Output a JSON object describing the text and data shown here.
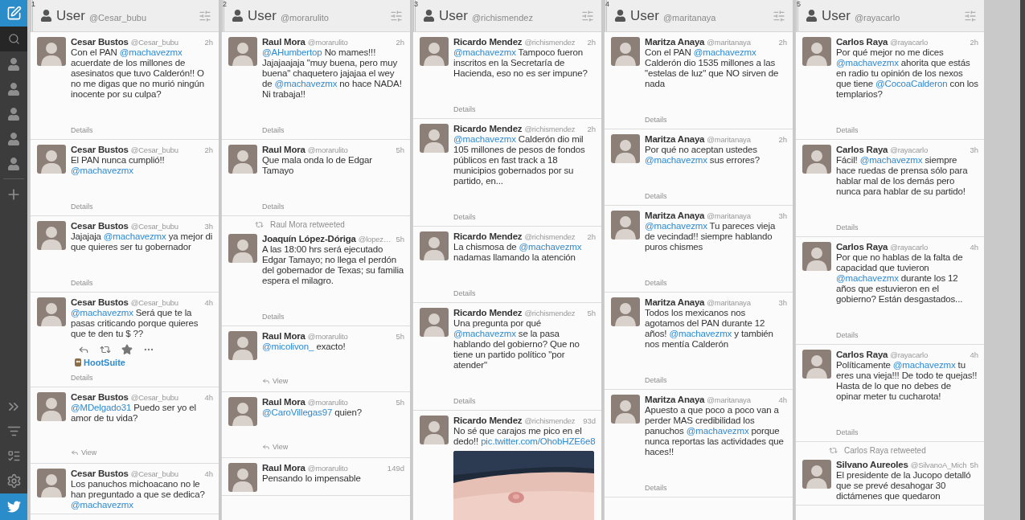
{
  "sidebar": {
    "top": [
      {
        "kind": "compose",
        "selected": false
      },
      {
        "kind": "search",
        "selected": true
      },
      {
        "kind": "user",
        "selected": false
      },
      {
        "kind": "user",
        "selected": false
      },
      {
        "kind": "user",
        "selected": false
      },
      {
        "kind": "user",
        "selected": false
      },
      {
        "kind": "user",
        "selected": false
      },
      {
        "kind": "add",
        "selected": false
      }
    ],
    "bottom": [
      {
        "kind": "expand"
      },
      {
        "kind": "list-users"
      },
      {
        "kind": "list-tools"
      },
      {
        "kind": "settings"
      },
      {
        "kind": "twitter"
      }
    ]
  },
  "columns": [
    {
      "number": "1",
      "title": "User",
      "handle": "@Cesar_bubu",
      "tweets": [
        {
          "name": "Cesar Bustos",
          "handle": "@Cesar_bubu",
          "time": "2h",
          "text": [
            "Con el PAN ",
            {
              "link": "@machavezmx"
            },
            " acuerdate de los millones de asesinatos que tuvo Calderón!! O no me digas que no murió ningún inocente por su culpa?"
          ],
          "footer": {
            "kind": "details",
            "label": "Details"
          }
        },
        {
          "name": "Cesar Bustos",
          "handle": "@Cesar_bubu",
          "time": "2h",
          "text": [
            "El PAN nunca cumplió!! ",
            {
              "link": "@machavezmx"
            }
          ],
          "footer": {
            "kind": "details",
            "label": "Details"
          }
        },
        {
          "name": "Cesar Bustos",
          "handle": "@Cesar_bubu",
          "time": "3h",
          "text": [
            "Jajajaja ",
            {
              "link": "@machavezmx"
            },
            " ya mejor di que quieres ser tu gobernador"
          ],
          "footer": {
            "kind": "details",
            "label": "Details"
          }
        },
        {
          "name": "Cesar Bustos",
          "handle": "@Cesar_bubu",
          "time": "4h",
          "text": [
            {
              "link": "@machavezmx"
            },
            " Será que te la pasas criticando porque quieres que te den tu $ ??"
          ],
          "hovered": true,
          "via": "HootSuite",
          "footer": {
            "kind": "details",
            "label": "Details"
          }
        },
        {
          "name": "Cesar Bustos",
          "handle": "@Cesar_bubu",
          "time": "4h",
          "text": [
            {
              "link": "@MDelgado31"
            },
            " Puedo ser yo el amor de tu vida?"
          ],
          "footer": {
            "kind": "conversation",
            "label": "View"
          }
        },
        {
          "name": "Cesar Bustos",
          "handle": "@Cesar_bubu",
          "time": "4h",
          "text": [
            "Los panuchos michoacano no le han preguntado a que se dedica? ",
            {
              "link": "@machavezmx"
            }
          ]
        }
      ]
    },
    {
      "number": "2",
      "title": "User",
      "handle": "@morarulito",
      "tweets": [
        {
          "name": "Raul Mora",
          "handle": "@morarulito",
          "time": "2h",
          "text": [
            {
              "link": "@AHumbertop"
            },
            " No mames!!! Jajajaajaja \"muy buena, pero muy buena\" chaquetero jajajaa el wey de ",
            {
              "link": "@machavezmx"
            },
            " no hace NADA! Ni trabaja!!"
          ],
          "footer": {
            "kind": "details",
            "label": "Details"
          }
        },
        {
          "name": "Raul Mora",
          "handle": "@morarulito",
          "time": "5h",
          "text": [
            "Que mala onda lo de Edgar Tamayo"
          ],
          "footer": {
            "kind": "details",
            "label": "Details"
          }
        },
        {
          "retweeted_by": "Raul Mora retweeted",
          "name": "Joaquín López-Dóriga",
          "handle": "@lopez…",
          "time": "5h",
          "text": [
            "A las 18:00 hrs será ejecutado Edgar Tamayo; no llega el perdón del gobernador de Texas; su familia espera el milagro."
          ],
          "footer": {
            "kind": "details",
            "label": "Details"
          }
        },
        {
          "name": "Raul Mora",
          "handle": "@morarulito",
          "time": "5h",
          "text": [
            {
              "link": "@micolivon_"
            },
            " exacto!"
          ],
          "footer": {
            "kind": "conversation",
            "label": "View"
          }
        },
        {
          "name": "Raul Mora",
          "handle": "@morarulito",
          "time": "5h",
          "text": [
            {
              "link": "@CaroVillegas97"
            },
            " quien?"
          ],
          "footer": {
            "kind": "conversation",
            "label": "View"
          }
        },
        {
          "name": "Raul Mora",
          "handle": "@morarulito",
          "time": "149d",
          "text": [
            "Pensando lo impensable"
          ]
        }
      ]
    },
    {
      "number": "3",
      "title": "User",
      "handle": "@richismendez",
      "tweets": [
        {
          "name": "Ricardo Mendez",
          "handle": "@richismendez",
          "time": "2h",
          "text": [
            {
              "link": "@machavezmx"
            },
            " Tampoco fueron inscritos en la Secretaría de Hacienda, eso no es ser impune?"
          ],
          "footer": {
            "kind": "details",
            "label": "Details"
          }
        },
        {
          "name": "Ricardo Mendez",
          "handle": "@richismendez",
          "time": "2h",
          "text": [
            {
              "link": "@machavezmx"
            },
            " Calderón dio mil 105 millones de pesos de fondos públicos en fast track a 18 municipios gobernados por su partido, en..."
          ],
          "footer": {
            "kind": "details",
            "label": "Details"
          }
        },
        {
          "name": "Ricardo Mendez",
          "handle": "@richismendez",
          "time": "2h",
          "text": [
            "La chismosa de ",
            {
              "link": "@machavezmx"
            },
            " nadamas llamando la atención"
          ],
          "footer": {
            "kind": "details",
            "label": "Details"
          }
        },
        {
          "name": "Ricardo Mendez",
          "handle": "@richismendez",
          "time": "5h",
          "text": [
            "Una pregunta por qué ",
            {
              "link": "@machavezmx"
            },
            " se la pasa hablando del gobierno? Que no tiene un partido político \"por atender\""
          ],
          "footer": {
            "kind": "details",
            "label": "Details"
          }
        },
        {
          "name": "Ricardo Mendez",
          "handle": "@richismendez",
          "time": "93d",
          "text": [
            "No sé que carajos me pico en el dedo!! ",
            {
              "link": "pic.twitter.com/OhobHZE6e8"
            }
          ],
          "media": {
            "kind": "picture"
          }
        }
      ]
    },
    {
      "number": "4",
      "title": "User",
      "handle": "@maritanaya",
      "tweets": [
        {
          "name": "Maritza Anaya",
          "handle": "@maritanaya",
          "time": "2h",
          "text": [
            "Con el PAN ",
            {
              "link": "@machavezmx"
            },
            " Calderón dio 1535 millones a las \"estelas de luz\" que NO sirven de nada"
          ],
          "footer": {
            "kind": "details",
            "label": "Details"
          }
        },
        {
          "name": "Maritza Anaya",
          "handle": "@maritanaya",
          "time": "2h",
          "text": [
            "Por qué no aceptan ustedes ",
            {
              "link": "@machavezmx"
            },
            " sus errores?"
          ],
          "footer": {
            "kind": "details",
            "label": "Details"
          }
        },
        {
          "name": "Maritza Anaya",
          "handle": "@maritanaya",
          "time": "3h",
          "text": [
            {
              "link": "@machavezmx"
            },
            " Tu pareces vieja de vecindad!! siempre hablando puros chismes"
          ],
          "footer": {
            "kind": "details",
            "label": "Details"
          }
        },
        {
          "name": "Maritza Anaya",
          "handle": "@maritanaya",
          "time": "3h",
          "text": [
            "Todos los mexicanos nos agotamos del PAN durante 12 años! ",
            {
              "link": "@machavezmx"
            },
            " y también nos mentía Calderón"
          ],
          "footer": {
            "kind": "details",
            "label": "Details"
          }
        },
        {
          "name": "Maritza Anaya",
          "handle": "@maritanaya",
          "time": "4h",
          "text": [
            "Apuesto a que poco a poco van a perder MAS credibilidad los panuchos ",
            {
              "link": "@machavezmx"
            },
            " porque nunca reportas las actividades que haces!!"
          ],
          "footer": {
            "kind": "details",
            "label": "Details"
          }
        }
      ]
    },
    {
      "number": "5",
      "title": "User",
      "handle": "@rayacarlo",
      "tweets": [
        {
          "name": "Carlos Raya",
          "handle": "@rayacarlo",
          "time": "2h",
          "text": [
            "Por qué mejor no me dices ",
            {
              "link": "@machavezmx"
            },
            " ahorita que estás en radio tu opinión de los nexos que tiene ",
            {
              "link": "@CocoaCalderon"
            },
            " con los templarios?"
          ],
          "footer": {
            "kind": "details",
            "label": "Details"
          }
        },
        {
          "name": "Carlos Raya",
          "handle": "@rayacarlo",
          "time": "3h",
          "text": [
            "Fácil! ",
            {
              "link": "@machavezmx"
            },
            " siempre hace ruedas de prensa sólo para hablar mal de los demás pero nunca para hablar de su partido!"
          ],
          "footer": {
            "kind": "details",
            "label": "Details"
          }
        },
        {
          "name": "Carlos Raya",
          "handle": "@rayacarlo",
          "time": "4h",
          "text": [
            "Por que no hablas de la falta de capacidad que tuvieron ",
            {
              "link": "@machavezmx"
            },
            " durante los 12 años que estuvieron en el gobierno? Están desgastados..."
          ],
          "footer": {
            "kind": "details",
            "label": "Details"
          }
        },
        {
          "name": "Carlos Raya",
          "handle": "@rayacarlo",
          "time": "4h",
          "text": [
            "Políticamente ",
            {
              "link": "@machavezmx"
            },
            " tu eres una vieja!!! De todo te quejas!! Hasta de lo que no debes de opinar meter tu cucharota!"
          ],
          "footer": {
            "kind": "details",
            "label": "Details"
          }
        },
        {
          "retweeted_by": "Carlos Raya retweeted",
          "name": "Silvano Aureoles",
          "handle": "@SilvanoA_Mich",
          "time": "5h",
          "text": [
            "El presidente de la Jucopo detalló que se prevé desahogar 30 dictámenes que quedaron"
          ]
        }
      ]
    }
  ]
}
